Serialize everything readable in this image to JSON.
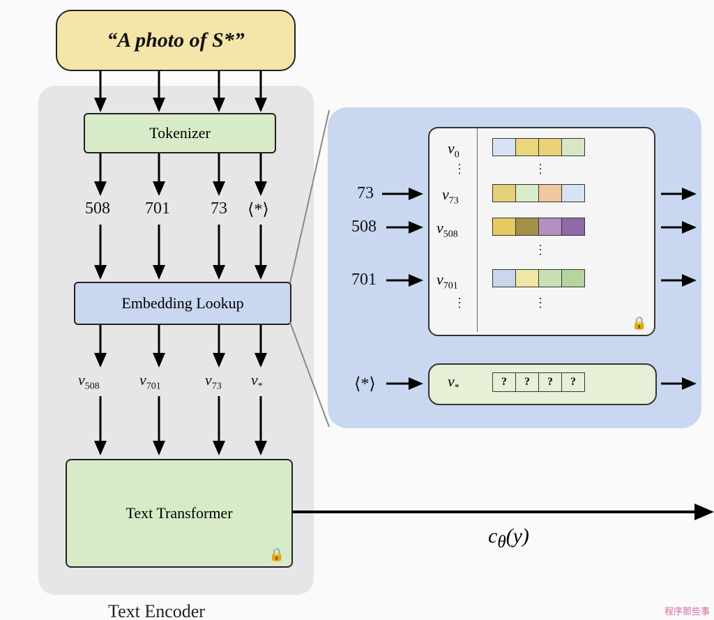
{
  "input_prompt": "“A photo of S*”",
  "blocks": {
    "tokenizer": "Tokenizer",
    "embedding": "Embedding Lookup",
    "transformer": "Text Transformer",
    "encoder_label": "Text Encoder"
  },
  "tokens": [
    "508",
    "701",
    "73",
    "⟨*⟩"
  ],
  "vectors": [
    "v₅₀₈",
    "v₇₀₁",
    "v₇₃",
    "v*"
  ],
  "lookup_inputs": [
    "73",
    "508",
    "701"
  ],
  "placeholder_input": "⟨*⟩",
  "lookup_rows": {
    "v0": "v₀",
    "v73": "v₇₃",
    "v508": "v₅₀₈",
    "v701": "v₇₀₁",
    "vstar": "v*"
  },
  "placeholder_cell": "?",
  "cell_colors": {
    "row_v0": [
      "#d7e3f5",
      "#ead77a",
      "#ecd07a",
      "#d6e7c8"
    ],
    "row_v73": [
      "#e4d07a",
      "#d8ecc8",
      "#efc7a0",
      "#d7e3f5"
    ],
    "row_v508": [
      "#e6c960",
      "#a39045",
      "#b48fc0",
      "#8e6aa6"
    ],
    "row_v701": [
      "#c8d7ee",
      "#f2e6a6",
      "#c7e0b4",
      "#b6d49e"
    ]
  },
  "output_label": "cθ(y)",
  "watermark": "程序那些事"
}
